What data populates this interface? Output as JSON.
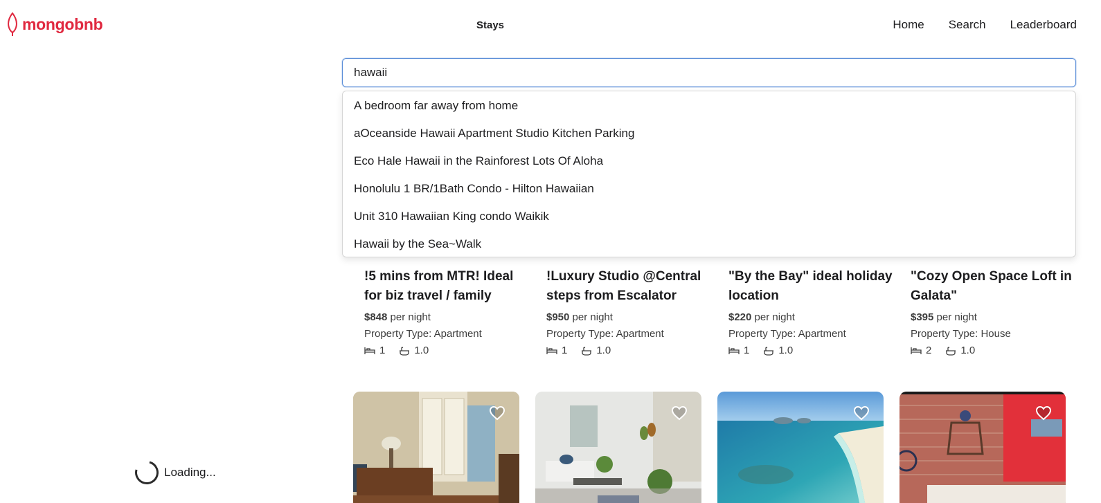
{
  "header": {
    "logo_text": "mongobnb",
    "center_label": "Stays",
    "nav": [
      "Home",
      "Search",
      "Leaderboard"
    ]
  },
  "search": {
    "value": "hawaii",
    "suggestions": [
      "A bedroom far away from home",
      "aOceanside Hawaii Apartment Studio Kitchen Parking",
      "Eco Hale Hawaii in the Rainforest Lots Of Aloha",
      "Honolulu 1 BR/1Bath Condo - Hilton Hawaiian",
      "Unit 310 Hawaiian King condo Waikik",
      "Hawaii by the Sea~Walk"
    ]
  },
  "listings": [
    {
      "title": "!5 mins from MTR! Ideal for biz travel / family",
      "price": "$848",
      "per": "per night",
      "type": "Property Type: Apartment",
      "beds": "1",
      "baths": "1.0"
    },
    {
      "title": "!Luxury Studio @Central steps from Escalator",
      "price": "$950",
      "per": "per night",
      "type": "Property Type: Apartment",
      "beds": "1",
      "baths": "1.0"
    },
    {
      "title": "\"By the Bay\" ideal holiday location",
      "price": "$220",
      "per": "per night",
      "type": "Property Type: Apartment",
      "beds": "1",
      "baths": "1.0"
    },
    {
      "title": "\"Cozy Open Space Loft in Galata\"",
      "price": "$395",
      "per": "per night",
      "type": "Property Type: House",
      "beds": "2",
      "baths": "1.0"
    }
  ],
  "photos": [
    {
      "icon": "heart-icon"
    },
    {
      "icon": "heart-icon"
    },
    {
      "icon": "heart-icon"
    },
    {
      "icon": "heart-icon"
    }
  ],
  "status": {
    "loading": "Loading..."
  },
  "colors": {
    "brand": "#e0283f",
    "focus": "#5b8ed8"
  }
}
